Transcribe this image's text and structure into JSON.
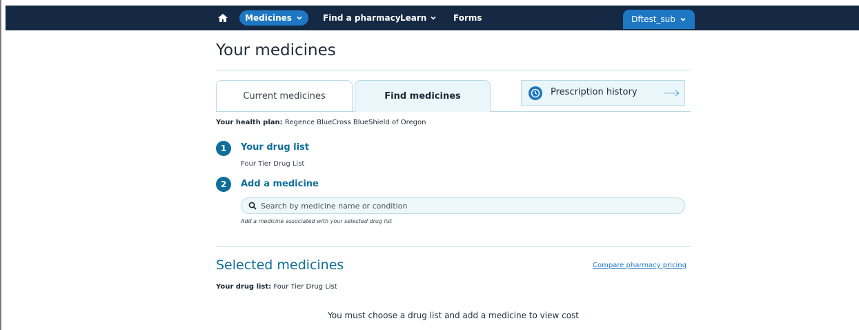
{
  "nav": {
    "home_icon": "home-icon",
    "medicines_label": "Medicines",
    "find_pharmacy_label": "Find a pharmacy",
    "learn_label": "Learn",
    "forms_label": "Forms",
    "user_label": "Dftest_sub"
  },
  "page": {
    "title": "Your medicines"
  },
  "tabs": [
    {
      "label": "Current medicines",
      "active": false
    },
    {
      "label": "Find medicines",
      "active": true
    }
  ],
  "prescription_history": {
    "label": "Prescription history",
    "icon": "clock-icon"
  },
  "health_plan": {
    "label": "Your health plan:",
    "value": "Regence BlueCross BlueShield of Oregon"
  },
  "steps": [
    {
      "number": "1",
      "title": "Your drug list",
      "subtitle": "Four Tier Drug List"
    },
    {
      "number": "2",
      "title": "Add a medicine"
    }
  ],
  "search": {
    "placeholder": "Search by medicine name or condition",
    "hint": "Add a medicine associated with your selected drug list"
  },
  "selected": {
    "title": "Selected medicines",
    "compare_link": "Compare pharmacy pricing",
    "drug_list_label": "Your drug list:",
    "drug_list_value": "Four Tier Drug List",
    "empty_message": "You must choose a drug list and add a medicine to view cost"
  },
  "colors": {
    "nav_bg": "#162944",
    "accent": "#1e77c2",
    "teal": "#0f6e9a"
  }
}
